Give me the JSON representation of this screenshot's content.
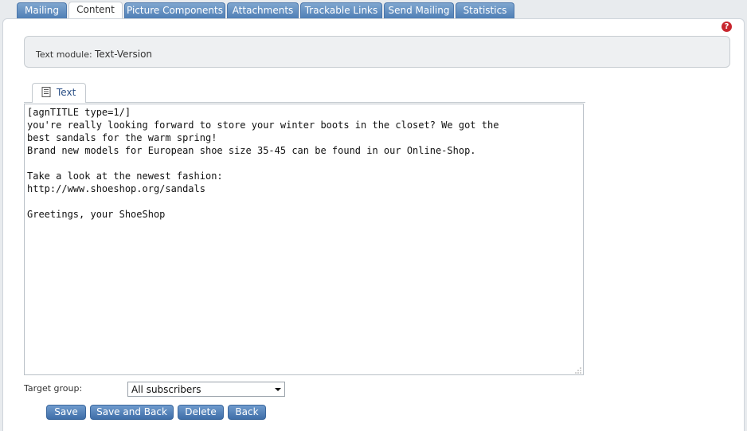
{
  "tabs": [
    {
      "label": "Mailing"
    },
    {
      "label": "Content"
    },
    {
      "label": "Picture Components"
    },
    {
      "label": "Attachments"
    },
    {
      "label": "Trackable Links"
    },
    {
      "label": "Send Mailing"
    },
    {
      "label": "Statistics"
    }
  ],
  "active_tab": "Content",
  "help": {
    "icon": "help-icon",
    "glyph": "?"
  },
  "module": {
    "label": "Text module:",
    "value": "Text-Version"
  },
  "text_tab": {
    "label": "Text",
    "icon": "document-icon"
  },
  "editor": {
    "content": "[agnTITLE type=1/]\nyou're really looking forward to store your winter boots in the closet? We got the\nbest sandals for the warm spring!\nBrand new models for European shoe size 35-45 can be found in our Online-Shop.\n\nTake a look at the newest fashion:\nhttp://www.shoeshop.org/sandals\n\nGreetings, your ShoeShop"
  },
  "target_group": {
    "label": "Target group:",
    "selected": "All subscribers"
  },
  "buttons": {
    "save": "Save",
    "save_and_back": "Save and Back",
    "delete": "Delete",
    "back": "Back"
  },
  "colors": {
    "tab": "#5b88bd",
    "button": "#4f7fb6",
    "help": "#c8262e"
  }
}
